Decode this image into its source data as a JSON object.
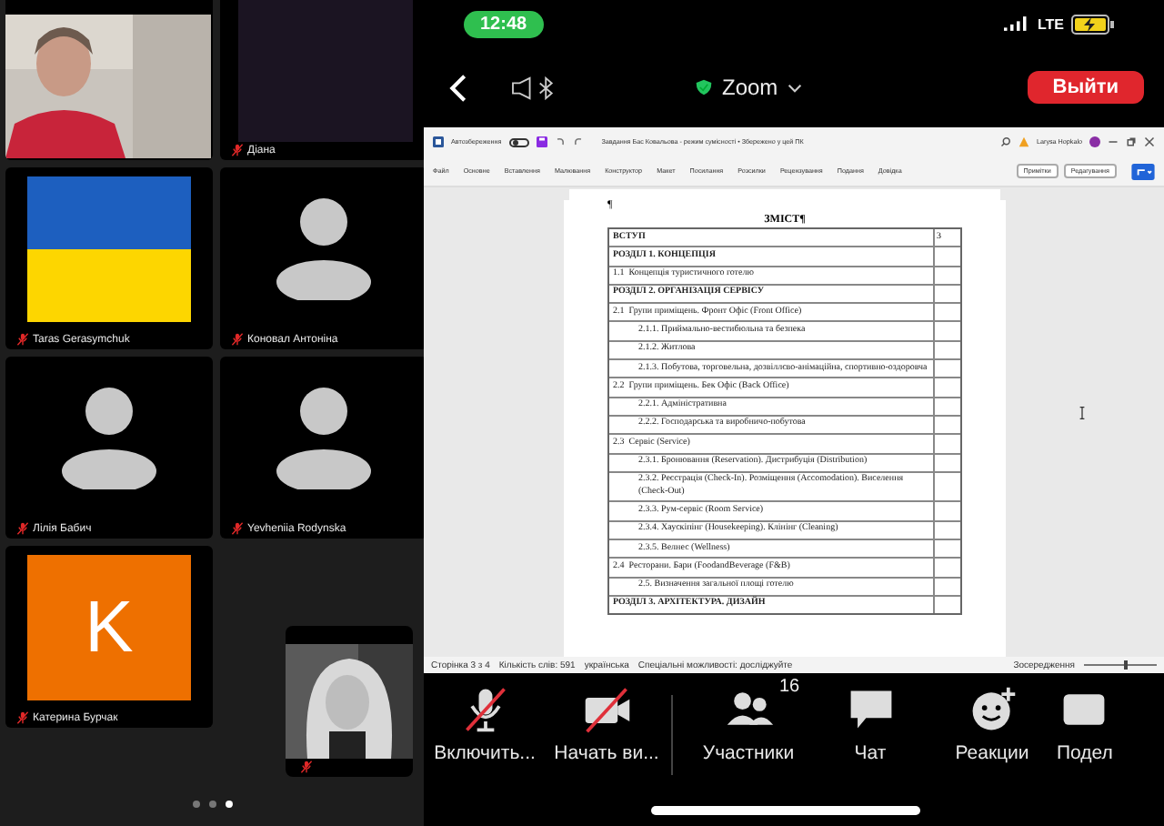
{
  "participants": [
    {
      "kind": "video"
    },
    {
      "name": "Діана",
      "kind": "dark",
      "muted": true
    },
    {
      "name": "Taras Gerasymchuk",
      "kind": "flag",
      "muted": true
    },
    {
      "name": "Коновал Антоніна",
      "kind": "silhouette",
      "muted": true
    },
    {
      "name": "Лілія Бабич",
      "kind": "silhouette",
      "muted": true
    },
    {
      "name": "Yevheniia Rodynska",
      "kind": "silhouette",
      "muted": true
    },
    {
      "name": "Катерина Бурчак",
      "kind": "initial",
      "initial": "K",
      "muted": true
    }
  ],
  "self_view": {
    "kind": "picture",
    "muted": true
  },
  "page_dots": [
    {
      "selected": false
    },
    {
      "selected": false
    },
    {
      "selected": true
    }
  ],
  "status_bar": {
    "time": "12:48",
    "network": "LTE"
  },
  "nav": {
    "title": "Zoom",
    "leave": "Выйти"
  },
  "word": {
    "autosave": "Автозбереження",
    "autosave_on": false,
    "title": "Завдання Бас Ковальова - режим сумісності • Збережено у цей ПК",
    "user": "Larysa Hopkalo",
    "menu": [
      "Файл",
      "Основне",
      "Вставлення",
      "Малювання",
      "Конструктор",
      "Макет",
      "Посилання",
      "Розсилки",
      "Рецензування",
      "Подання",
      "Довідка"
    ],
    "comments": "Примітки",
    "editing": "Редагування",
    "pilcrow": "¶",
    "heading": "ЗМІСТ¶",
    "toc": [
      {
        "kind": "section",
        "title": "ВСТУП",
        "page": "3"
      },
      {
        "kind": "section",
        "title": "РОЗДІЛ 1. КОНЦЕПЦІЯ"
      },
      {
        "kind": "item",
        "num": "1.1",
        "title": "Концепція туристичного готелю"
      },
      {
        "kind": "section",
        "title": "РОЗДІЛ 2. ОРГАНІЗАЦІЯ СЕРВІСУ"
      },
      {
        "kind": "item",
        "num": "2.1",
        "title": "Групи приміщень. Фронт Офіс (Front Office)"
      },
      {
        "kind": "subitem",
        "title": "2.1.1. Приймально-вестибюльна та безпека"
      },
      {
        "kind": "subitem",
        "title": "2.1.2. Житлова"
      },
      {
        "kind": "subitem",
        "title": "2.1.3. Побутова, торговельна, дозвіллєво-анімаційна, спортивно-оздоровча"
      },
      {
        "kind": "item",
        "num": "2.2",
        "title": "Групи приміщень. Бек Офіс (Back Office)"
      },
      {
        "kind": "subitem",
        "title": "2.2.1. Адміністративна"
      },
      {
        "kind": "subitem",
        "title": "2.2.2. Господарська та виробничо-побутова"
      },
      {
        "kind": "item",
        "num": "2.3",
        "title": "Сервіс (Service)"
      },
      {
        "kind": "subitem",
        "title": "2.3.1. Бронювання (Reservation). Дистрибуція (Distribution)"
      },
      {
        "kind": "subitem",
        "title": "2.3.2. Реєстрація (Check-In). Розміщення (Accomodation). Виселення (Check-Out)"
      },
      {
        "kind": "subitem",
        "title": "2.3.3. Рум-сервіс (Room Service)"
      },
      {
        "kind": "subitem",
        "title": "2.3.4. Хаускіпінг (Housekeeping). Клінінг (Cleaning)"
      },
      {
        "kind": "subitem",
        "title": "2.3.5. Велнес (Wellness)"
      },
      {
        "kind": "item",
        "num": "2.4",
        "title": "Ресторани. Бари (FoodandBeverage (F&B)"
      },
      {
        "kind": "subitem",
        "title": "2.5. Визначення загальної площі готелю"
      },
      {
        "kind": "section",
        "title": "РОЗДІЛ 3. АРХІТЕКТУРА. ДИЗАЙН"
      }
    ],
    "status": [
      "Сторінка 3 з 4",
      "Кількість слів: 591",
      "українська",
      "Спеціальні можливості: досліджуйте"
    ],
    "focus": "Зосередження"
  },
  "toolbar": [
    {
      "kind": "mic",
      "label": "Включить...",
      "off": true
    },
    {
      "kind": "video",
      "label": "Начать ви...",
      "off": true
    },
    {
      "kind": "participants",
      "label": "Участники",
      "badge": "16"
    },
    {
      "kind": "chat",
      "label": "Чат"
    },
    {
      "kind": "reactions",
      "label": "Реакции"
    },
    {
      "kind": "share",
      "label": "Подел"
    }
  ]
}
